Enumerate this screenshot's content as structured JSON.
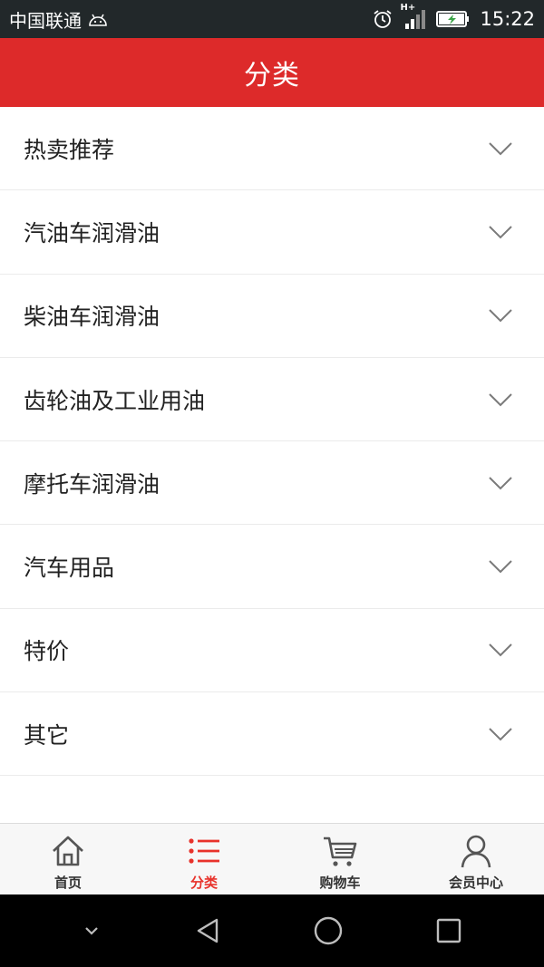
{
  "status_bar": {
    "carrier": "中国联通",
    "network": "H+",
    "time": "15:22"
  },
  "header": {
    "title": "分类",
    "bg_color": "#dd2a2a"
  },
  "categories": [
    {
      "label": "热卖推荐"
    },
    {
      "label": "汽油车润滑油"
    },
    {
      "label": "柴油车润滑油"
    },
    {
      "label": "齿轮油及工业用油"
    },
    {
      "label": "摩托车润滑油"
    },
    {
      "label": "汽车用品"
    },
    {
      "label": "特价"
    },
    {
      "label": "其它"
    }
  ],
  "tab_bar": {
    "tabs": [
      {
        "label": "首页",
        "icon": "home-icon"
      },
      {
        "label": "分类",
        "icon": "list-icon",
        "active": true
      },
      {
        "label": "购物车",
        "icon": "cart-icon"
      },
      {
        "label": "会员中心",
        "icon": "user-icon"
      }
    ],
    "active_color": "#e8322b"
  },
  "nav_bar": {
    "buttons": [
      "chevron-down-icon",
      "back-icon",
      "home-circle-icon",
      "recents-icon"
    ]
  }
}
